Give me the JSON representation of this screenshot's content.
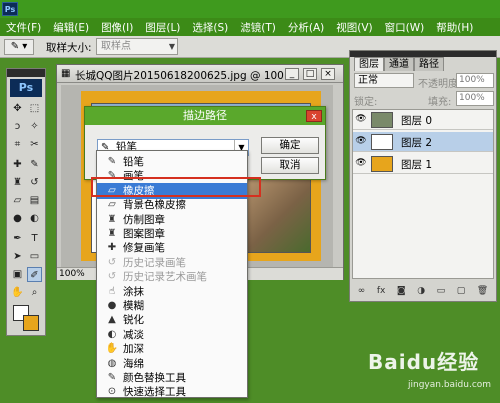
{
  "app": {
    "logo": "Ps"
  },
  "menubar": [
    "文件(F)",
    "编辑(E)",
    "图像(I)",
    "图层(L)",
    "选择(S)",
    "滤镜(T)",
    "分析(A)",
    "视图(V)",
    "窗口(W)",
    "帮助(H)"
  ],
  "options_bar": {
    "sample_size_label": "取样大小:",
    "sample_size_value": "取样点"
  },
  "document": {
    "title": "长城QQ图片20150618200625.jpg @ 100...",
    "zoom": "100%"
  },
  "stroke_dialog": {
    "title": "描边路径",
    "tool_label": "铅笔",
    "ok": "确定",
    "cancel": "取消",
    "close": "x"
  },
  "tool_dropdown": {
    "items": [
      {
        "label": "铅笔",
        "icon": "pencil-icon",
        "state": "normal"
      },
      {
        "label": "画笔",
        "icon": "brush-icon",
        "state": "normal"
      },
      {
        "label": "橡皮擦",
        "icon": "eraser-icon",
        "state": "selected"
      },
      {
        "label": "背景色橡皮擦",
        "icon": "background-eraser-icon",
        "state": "normal"
      },
      {
        "label": "仿制图章",
        "icon": "clone-stamp-icon",
        "state": "normal"
      },
      {
        "label": "图案图章",
        "icon": "pattern-stamp-icon",
        "state": "normal"
      },
      {
        "label": "修复画笔",
        "icon": "healing-brush-icon",
        "state": "normal"
      },
      {
        "label": "历史记录画笔",
        "icon": "history-brush-icon",
        "state": "disabled"
      },
      {
        "label": "历史记录艺术画笔",
        "icon": "art-history-brush-icon",
        "state": "disabled"
      },
      {
        "label": "涂抹",
        "icon": "smudge-icon",
        "state": "normal"
      },
      {
        "label": "模糊",
        "icon": "blur-icon",
        "state": "normal"
      },
      {
        "label": "锐化",
        "icon": "sharpen-icon",
        "state": "normal"
      },
      {
        "label": "减淡",
        "icon": "dodge-icon",
        "state": "normal"
      },
      {
        "label": "加深",
        "icon": "burn-icon",
        "state": "normal"
      },
      {
        "label": "海绵",
        "icon": "sponge-icon",
        "state": "normal"
      },
      {
        "label": "颜色替换工具",
        "icon": "color-replacement-icon",
        "state": "normal"
      },
      {
        "label": "快速选择工具",
        "icon": "quick-selection-icon",
        "state": "normal"
      }
    ]
  },
  "layers_panel": {
    "tabs": [
      "图层",
      "通道",
      "路径"
    ],
    "blend_mode": "正常",
    "opacity_label": "不透明度:",
    "opacity_value": "100%",
    "lock_label": "锁定:",
    "fill_label": "填充:",
    "fill_value": "100%",
    "layers": [
      {
        "name": "图层 0",
        "thumb": "#7a8a6a",
        "active": false
      },
      {
        "name": "图层 2",
        "thumb": "#ffffff",
        "active": true
      },
      {
        "name": "图层 1",
        "thumb": "#e7a51c",
        "active": false
      }
    ]
  },
  "watermark": {
    "brand": "Baidu经验",
    "url": "jingyan.baidu.com"
  },
  "colors": {
    "menubar": "#3c8b17",
    "dialog_title": "#5aa82c",
    "selection": "#3a7bd5",
    "canvas_fill": "#e7a51c",
    "highlight": "#d5301f"
  }
}
